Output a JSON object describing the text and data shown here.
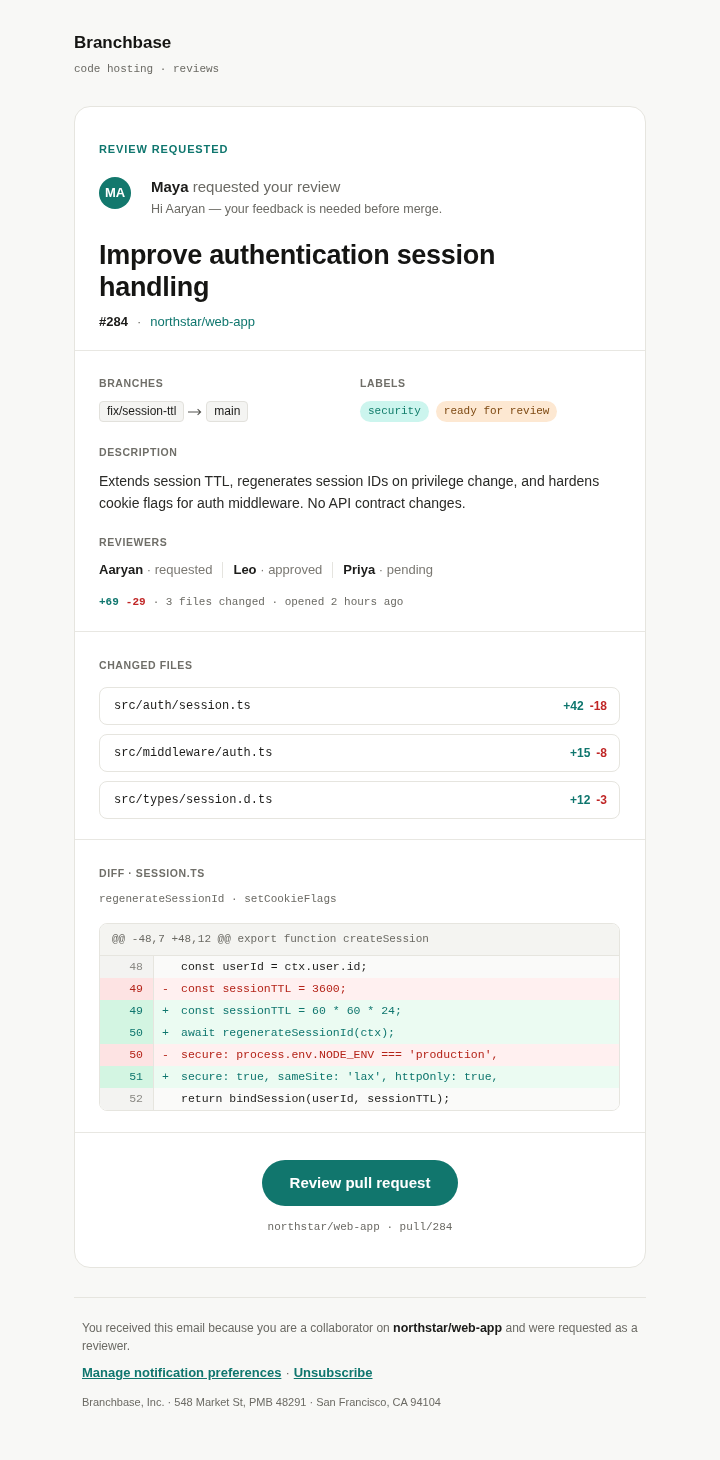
{
  "brand": {
    "name": "Branchbase",
    "tagline": "code hosting · reviews"
  },
  "request": {
    "eyebrow": "REVIEW REQUESTED",
    "avatar_initials": "MA",
    "headline": "**Maya** requested your review",
    "message": "Hi Aaryan — your feedback is needed before merge.",
    "title": "Improve authentication session handling",
    "number": "#284",
    "separator": "·",
    "repo": "northstar/web-app"
  },
  "details": {
    "branches_heading": "BRANCHES",
    "source_branch": "fix/session-ttl",
    "target_branch": "main",
    "labels_heading": "LABELS",
    "labels": [
      {
        "name": "security",
        "color": "#ccf5ee"
      },
      {
        "name": "ready for review",
        "color": "#fde8d2"
      }
    ],
    "description_heading": "DESCRIPTION",
    "description": "Extends session TTL, regenerates session IDs on privilege change, and hardens cookie flags for auth middleware. No API contract changes.",
    "reviewers_heading": "REVIEWERS",
    "reviewers": [
      "**Aaryan** · requested",
      "**Leo** · approved",
      "**Priya** · pending"
    ],
    "additions": "+69",
    "deletions": "-29",
    "summary": "· 3 files changed · opened 2 hours ago"
  },
  "changed_files": {
    "heading": "CHANGED FILES",
    "files": [
      {
        "path": "src/auth/session.ts",
        "additions": "+42",
        "deletions": "-18"
      },
      {
        "path": "src/middleware/auth.ts",
        "additions": "+15",
        "deletions": "-8"
      },
      {
        "path": "src/types/session.d.ts",
        "additions": "+12",
        "deletions": "-3"
      }
    ]
  },
  "diff": {
    "heading": "DIFF · SESSION.TS",
    "functions": "regenerateSessionId · setCookieFlags",
    "hunk_header": "@@ -48,7 +48,12 @@ export function createSession",
    "lines": [
      {
        "kind": "context",
        "number": "48",
        "code": "const userId = ctx.user.id;"
      },
      {
        "kind": "removed",
        "number": "49",
        "sign": "-",
        "code": "const sessionTTL = 3600;"
      },
      {
        "kind": "added",
        "number": "49",
        "sign": "+",
        "code": "const sessionTTL = 60 * 60 * 24;"
      },
      {
        "kind": "added",
        "number": "50",
        "sign": "+",
        "code": "await regenerateSessionId(ctx);"
      },
      {
        "kind": "removed",
        "number": "50",
        "sign": "-",
        "code": "secure: process.env.NODE_ENV === 'production',"
      },
      {
        "kind": "added",
        "number": "51",
        "sign": "+",
        "code": "secure: true, sameSite: 'lax', httpOnly: true,"
      },
      {
        "kind": "context",
        "number": "52",
        "code": "return bindSession(userId, sessionTTL);"
      }
    ]
  },
  "call_to_action": {
    "button": "Review pull request",
    "caption": "northstar/web-app · pull/284"
  },
  "footer": {
    "notice": "You received this email because you are a collaborator on **northstar/web-app** and were requested as a reviewer.",
    "links": [
      "Manage notification preferences",
      "Unsubscribe"
    ],
    "link_separator": "·",
    "address": "Branchbase, Inc. · 548 Market St, PMB 48291 · San Francisco, CA 94104"
  }
}
